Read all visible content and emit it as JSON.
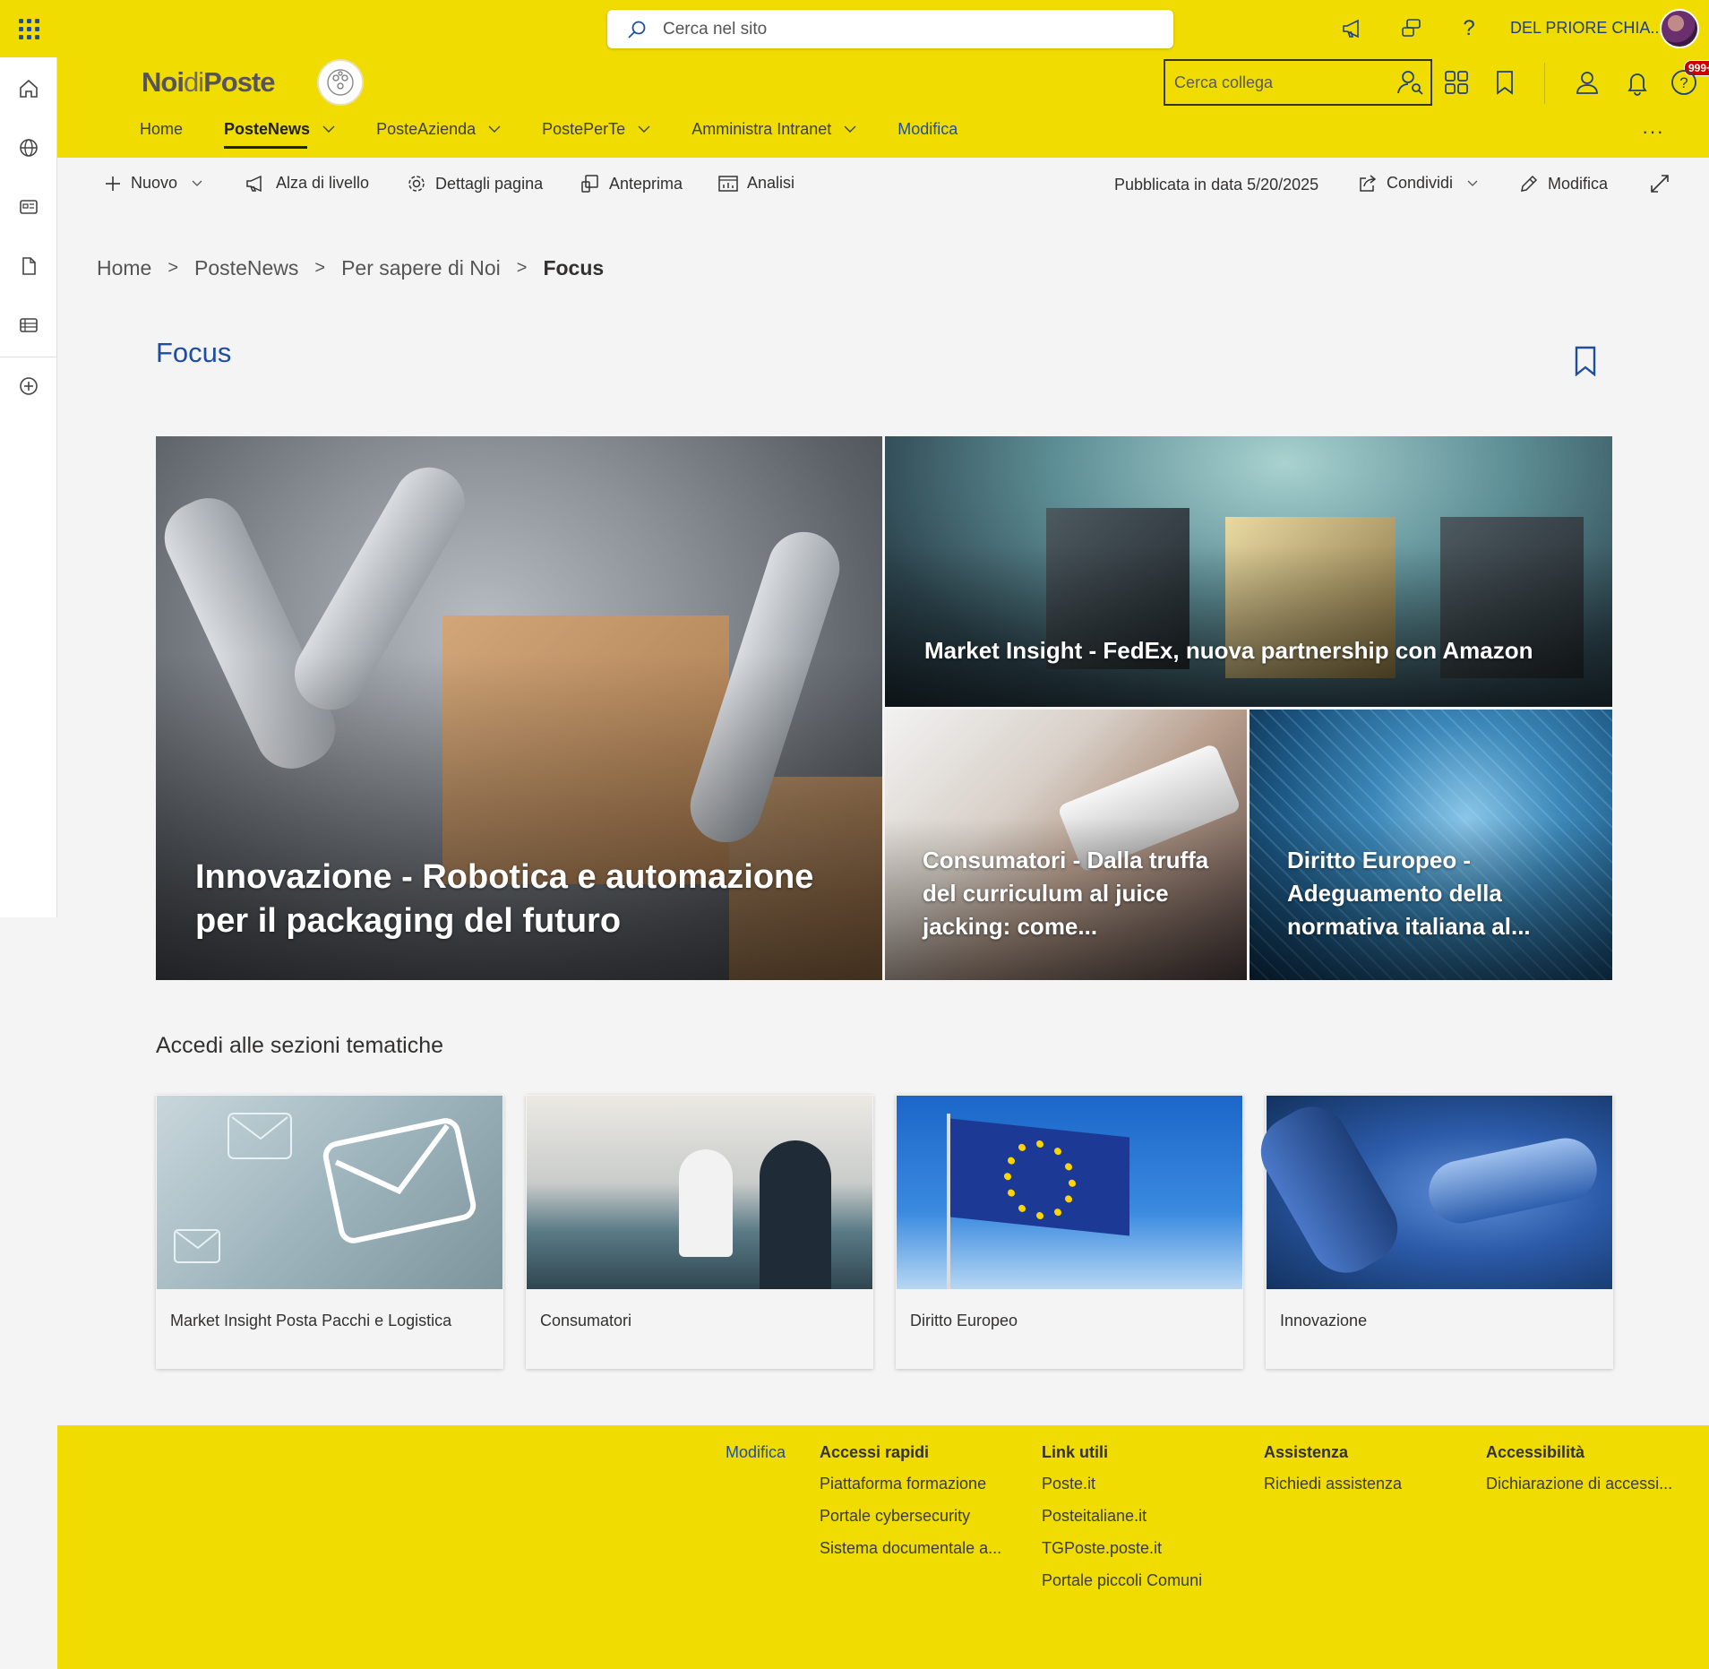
{
  "suitebar": {
    "search_placeholder": "Cerca nel sito",
    "user_name": "DEL PRIORE CHIA..."
  },
  "site": {
    "logo_bold1": "Noi",
    "logo_di": "di",
    "logo_bold2": "Poste",
    "colleague_search": "Cerca collega",
    "notification_badge": "999+",
    "nav": [
      {
        "label": "Home"
      },
      {
        "label": "PosteNews"
      },
      {
        "label": "PosteAzienda"
      },
      {
        "label": "PostePerTe"
      },
      {
        "label": "Amministra Intranet"
      }
    ],
    "nav_edit": "Modifica",
    "more": "···"
  },
  "cmdbar": {
    "new": "Nuovo",
    "promote": "Alza di livello",
    "page_details": "Dettagli pagina",
    "preview": "Anteprima",
    "analytics": "Analisi",
    "published": "Pubblicata in data 5/20/2025",
    "share": "Condividi",
    "edit": "Modifica"
  },
  "breadcrumb": {
    "items": [
      "Home",
      "PosteNews",
      "Per sapere di Noi"
    ],
    "current": "Focus",
    "separator": ">"
  },
  "page": {
    "title": "Focus"
  },
  "hero": {
    "main": "Innovazione - Robotica e automazione per il packaging del futuro",
    "top_right": "Market Insight - FedEx, nuova partnership con Amazon",
    "bottom_left": "Consumatori - Dalla truffa del curriculum al juice jacking: come...",
    "bottom_right": "Diritto Europeo - Adeguamento della normativa italiana al..."
  },
  "sections": {
    "title": "Accedi alle sezioni tematiche",
    "cards": [
      {
        "label": "Market Insight Posta Pacchi e Logistica"
      },
      {
        "label": "Consumatori"
      },
      {
        "label": "Diritto Europeo"
      },
      {
        "label": "Innovazione"
      }
    ]
  },
  "footer": {
    "edit": "Modifica",
    "columns": [
      {
        "title": "Accessi rapidi",
        "links": [
          "Piattaforma formazione",
          "Portale cybersecurity",
          "Sistema documentale a..."
        ]
      },
      {
        "title": "Link utili",
        "links": [
          "Poste.it",
          "Posteitaliane.it",
          "TGPoste.poste.it",
          "Portale piccoli Comuni"
        ]
      },
      {
        "title": "Assistenza",
        "links": [
          "Richiedi assistenza"
        ]
      },
      {
        "title": "Accessibilità",
        "links": [
          "Dichiarazione di accessi..."
        ]
      }
    ]
  },
  "colors": {
    "brand_yellow": "#f0dc00",
    "link_blue": "#1f4e9e",
    "badge_red": "#cc0000"
  }
}
